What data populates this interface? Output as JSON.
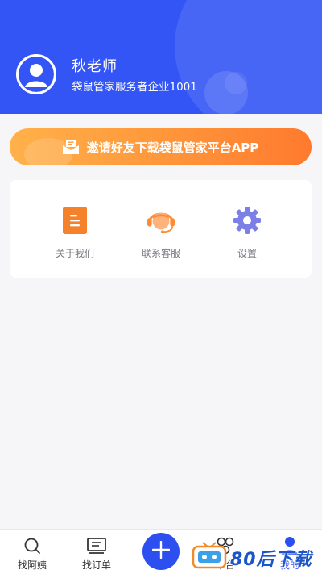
{
  "colors": {
    "header_bg": "#3355f5",
    "accent": "#2d4ff0",
    "banner_from": "#ffb14a",
    "banner_to": "#ff7a2e",
    "about_icon": "#f5822a",
    "service_icon": "#ff8a34",
    "settings_icon": "#7b7fe6"
  },
  "profile": {
    "name": "秋老师",
    "org": "袋鼠管家服务者企业1001",
    "avatar_icon": "user-avatar-icon"
  },
  "invite_banner": {
    "icon": "mail-icon",
    "text": "邀请好友下载袋鼠管家平台APP"
  },
  "menu": [
    {
      "label": "关于我们",
      "icon": "document-icon"
    },
    {
      "label": "联系客服",
      "icon": "headset-icon"
    },
    {
      "label": "设置",
      "icon": "gear-icon"
    }
  ],
  "tabbar": {
    "tabs": [
      {
        "label": "找阿姨",
        "icon": "search-icon"
      },
      {
        "label": "找订单",
        "icon": "order-list-icon"
      },
      {
        "label": "平台",
        "icon": "platform-icon"
      },
      {
        "label": "我的",
        "icon": "profile-icon",
        "active": true
      }
    ],
    "fab_icon": "plus-icon"
  },
  "watermark": {
    "text": "80后下载",
    "icon": "download-site-logo-icon"
  }
}
